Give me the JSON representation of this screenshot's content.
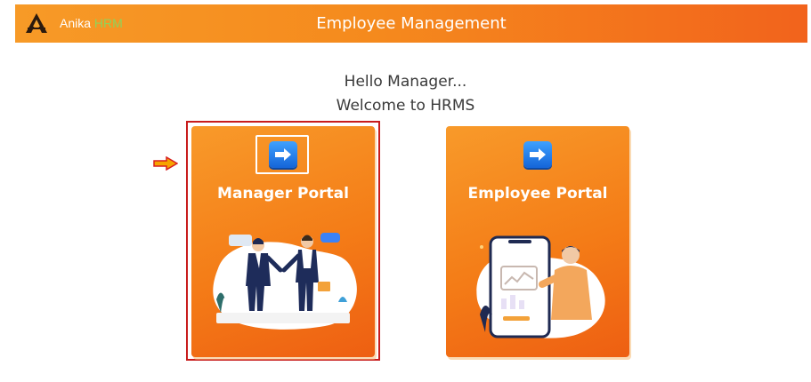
{
  "header": {
    "brand_name": "Anika",
    "brand_highlight": "HRM",
    "title": "Employee Management"
  },
  "greeting": {
    "line1": "Hello Manager...",
    "line2": "Welcome to HRMS"
  },
  "cards": [
    {
      "title": "Manager Portal",
      "icon": "arrow-right-icon",
      "illustration": "handshake-illustration"
    },
    {
      "title": "Employee Portal",
      "icon": "arrow-right-icon",
      "illustration": "phone-user-illustration"
    }
  ],
  "colors": {
    "header_start": "#f79a27",
    "header_end": "#f2631c",
    "brand_highlight": "#8fd35a",
    "card_orange": "#f47c17",
    "button_blue": "#1565d8",
    "highlight_red": "#c81c1c"
  }
}
